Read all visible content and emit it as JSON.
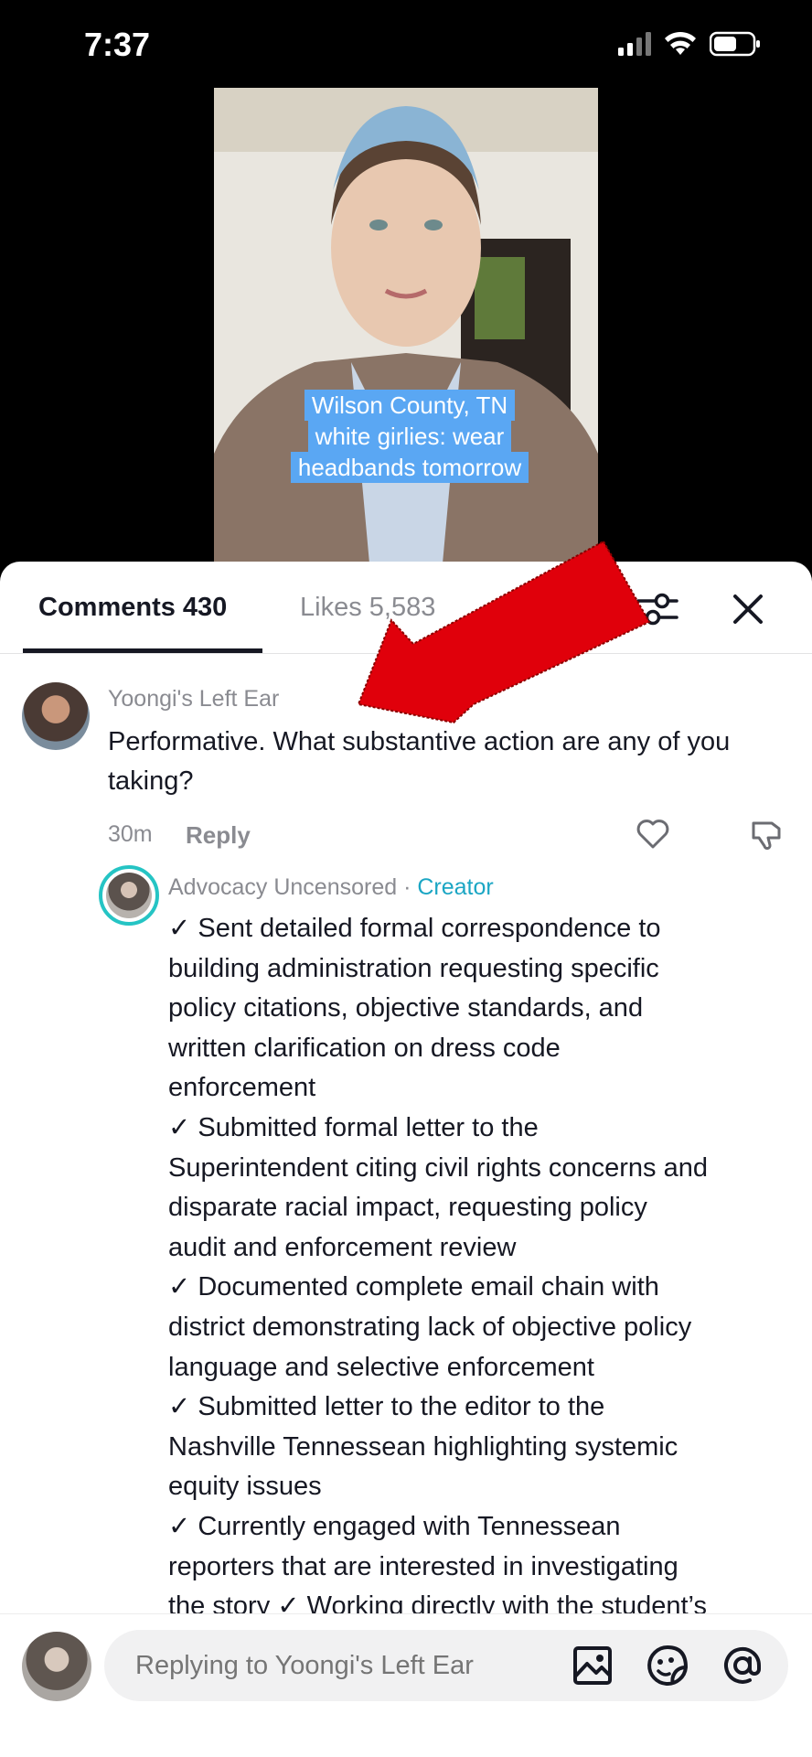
{
  "status_bar": {
    "time": "7:37"
  },
  "video": {
    "caption_lines": [
      "Wilson County, TN",
      "white girlies: wear",
      "headbands tomorrow"
    ]
  },
  "tabs": {
    "comments_label": "Comments 430",
    "likes_label": "Likes 5,583"
  },
  "comment": {
    "username": "Yoongi's Left Ear",
    "text": "Performative. What substantive action are any of you taking?",
    "time": "30m",
    "reply_label": "Reply"
  },
  "reply": {
    "username": "Advocacy Uncensored",
    "separator": " · ",
    "badge": "Creator",
    "lines": [
      "✓ Sent detailed formal correspondence to",
      "building administration requesting specific",
      "policy citations, objective standards, and",
      "written clarification on dress code",
      "enforcement",
      "✓ Submitted formal letter to the",
      "Superintendent citing civil rights concerns and",
      "disparate racial impact, requesting policy",
      "audit and enforcement review",
      "✓ Documented complete email chain with",
      "district demonstrating lack of objective policy",
      "language and selective enforcement",
      "✓ Submitted letter to the editor to the",
      "Nashville Tennessean highlighting systemic",
      "equity issues",
      "✓ Currently engaged with Tennessean",
      "reporters that are interested in investigating",
      "the story ✓ Working directly with the student’s"
    ]
  },
  "input": {
    "placeholder": "Replying to Yoongi's Left Ear"
  },
  "colors": {
    "creator_badge": "#1ba6c4",
    "caption_bg": "#5aa7f3",
    "annotation_arrow": "#e0000b"
  },
  "icons": [
    "signal-icon",
    "wifi-icon",
    "battery-icon",
    "filter-icon",
    "close-icon",
    "heart-icon",
    "dislike-icon",
    "image-icon",
    "sticker-icon",
    "mention-icon"
  ]
}
